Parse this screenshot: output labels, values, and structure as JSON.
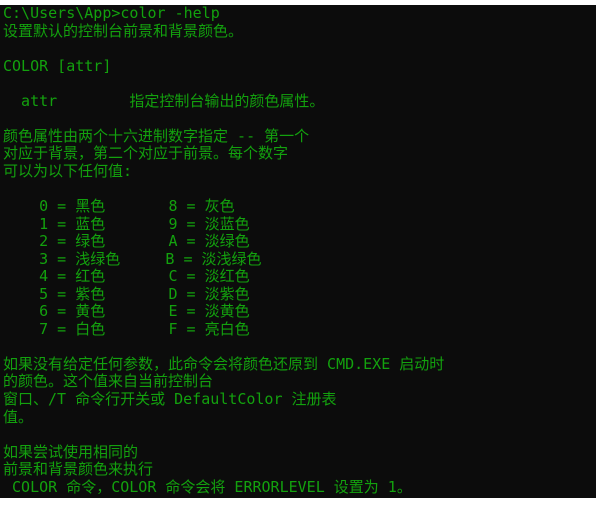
{
  "console": {
    "text_color": "#13a10e",
    "background": "#0c0c0c",
    "lines": [
      "C:\\Users\\App>color -help",
      "设置默认的控制台前景和背景颜色。",
      "",
      "COLOR [attr]",
      "",
      "  attr        指定控制台输出的颜色属性。",
      "",
      "颜色属性由两个十六进制数字指定 -- 第一个",
      "对应于背景，第二个对应于前景。每个数字",
      "可以为以下任何值:",
      "",
      "    0 = 黑色       8 = 灰色",
      "    1 = 蓝色       9 = 淡蓝色",
      "    2 = 绿色       A = 淡绿色",
      "    3 = 浅绿色     B = 淡浅绿色",
      "    4 = 红色       C = 淡红色",
      "    5 = 紫色       D = 淡紫色",
      "    6 = 黄色       E = 淡黄色",
      "    7 = 白色       F = 亮白色",
      "",
      "如果没有给定任何参数，此命令会将颜色还原到 CMD.EXE 启动时",
      "的颜色。这个值来自当前控制台",
      "窗口、/T 命令行开关或 DefaultColor 注册表",
      "值。",
      "",
      "如果尝试使用相同的",
      "前景和背景颜色来执行",
      " COLOR 命令，COLOR 命令会将 ERRORLEVEL 设置为 1。"
    ]
  }
}
